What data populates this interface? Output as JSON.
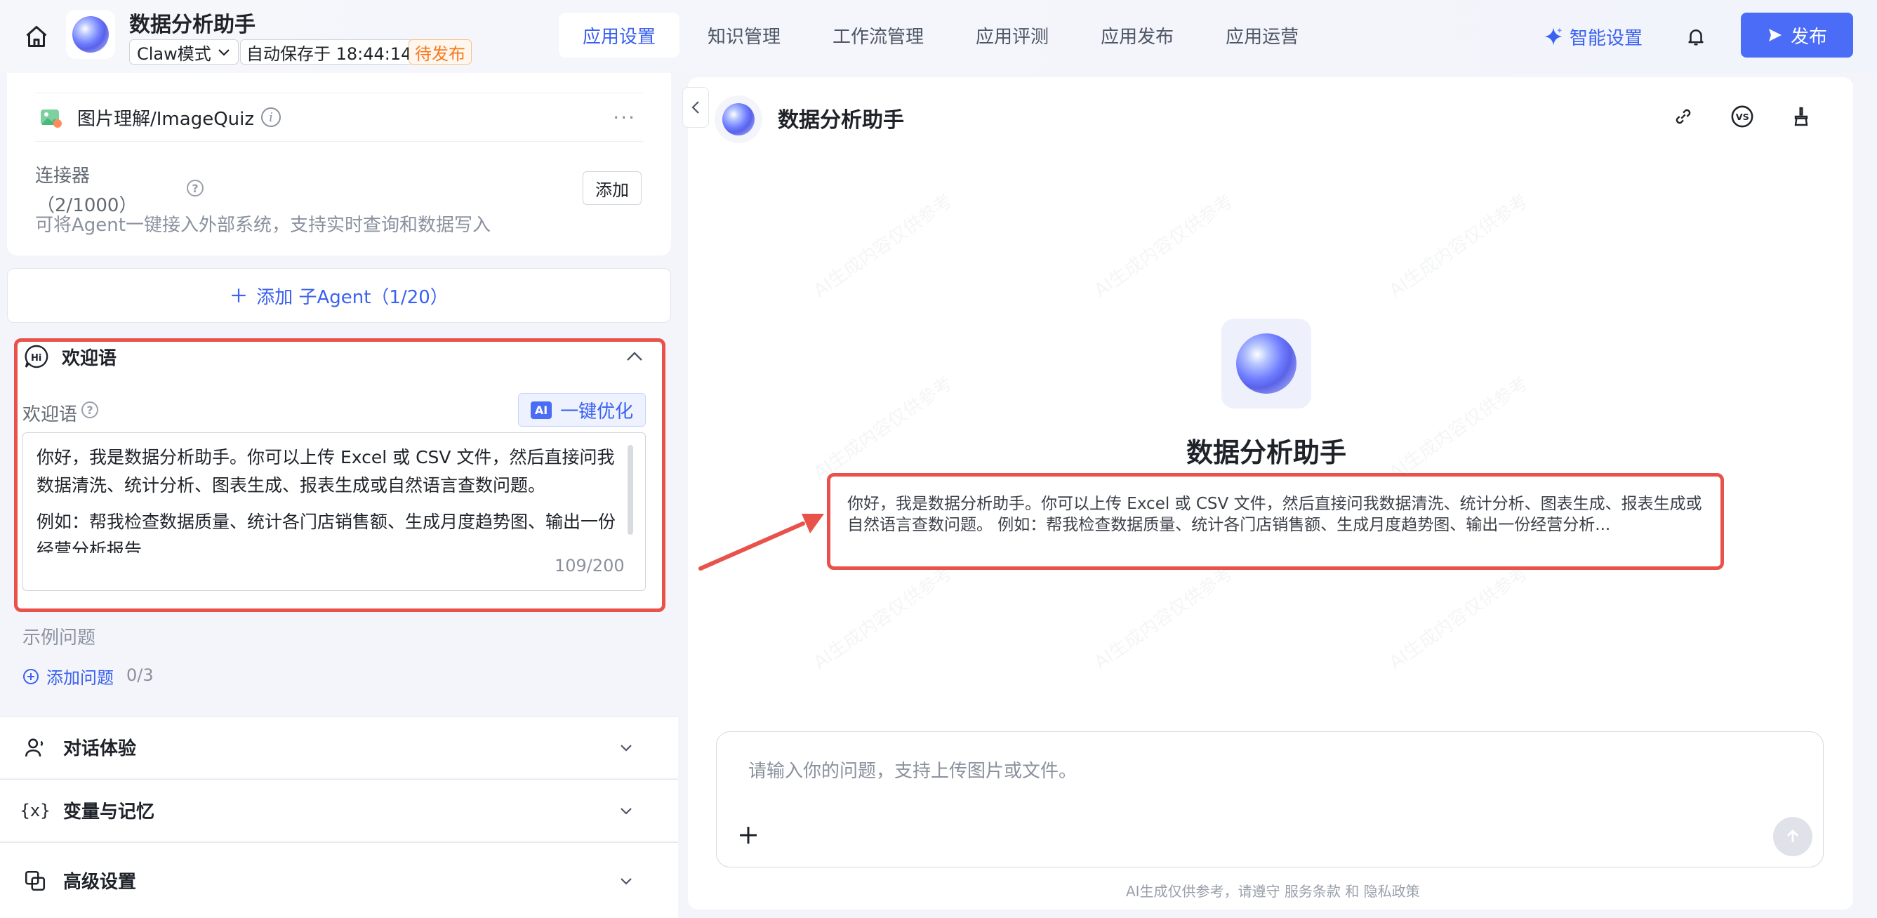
{
  "header": {
    "app_title": "数据分析助手",
    "mode_value": "Claw模式",
    "autosave": "自动保存于 18:44:14",
    "status_badge": "待发布",
    "tabs": [
      {
        "label": "应用设置",
        "active": true
      },
      {
        "label": "知识管理",
        "active": false
      },
      {
        "label": "工作流管理",
        "active": false
      },
      {
        "label": "应用评测",
        "active": false
      },
      {
        "label": "应用发布",
        "active": false
      },
      {
        "label": "应用运营",
        "active": false
      }
    ],
    "smart_settings": "智能设置",
    "publish": "发布",
    "icons": [
      "home-icon",
      "sparkle-icon",
      "bell-icon",
      "send-icon"
    ]
  },
  "left": {
    "plugin": {
      "name": "图片理解/ImageQuiz",
      "more": "···"
    },
    "connector": {
      "label": "连接器",
      "count": "（2/1000）",
      "description": "可将Agent一键接入外部系统，支持实时查询和数据写入",
      "add": "添加"
    },
    "add_subagent": "添加 子Agent（1/20）",
    "welcome": {
      "section_title": "欢迎语",
      "field_label": "欢迎语",
      "optimize_chip": "AI",
      "optimize_label": "一键优化",
      "text_p1": "你好，我是数据分析助手。你可以上传 Excel 或 CSV 文件，然后直接问我数据清洗、统计分析、图表生成、报表生成或自然语言查数问题。",
      "text_p2": "例如：帮我检查数据质量、统计各门店销售额、生成月度趋势图、输出一份经营分析报告",
      "char_count": "109/200"
    },
    "examples": {
      "label": "示例问题",
      "add": "添加问题",
      "count": "0/3"
    },
    "sections": [
      {
        "label": "对话体验",
        "icon": "user-voice-icon"
      },
      {
        "label": "变量与记忆",
        "icon": "variable-icon"
      },
      {
        "label": "高级设置",
        "icon": "copy-settings-icon"
      }
    ]
  },
  "preview": {
    "title": "数据分析助手",
    "center_title": "数据分析助手",
    "welcome_text": "你好，我是数据分析助手。你可以上传 Excel 或 CSV 文件，然后直接问我数据清洗、统计分析、图表生成、报表生成或自然语言查数问题。 例如：帮我检查数据质量、统计各门店销售额、生成月度趋势图、输出一份经营分析...",
    "input_placeholder": "请输入你的问题，支持上传图片或文件。",
    "disclaimer": "AI生成仅供参考，请遵守 服务条款 和 隐私政策",
    "watermark": "AI生成内容仅供参考",
    "tool_icons": [
      "link-icon",
      "vs-icon",
      "broom-icon"
    ]
  },
  "colors": {
    "accent": "#4a6cf7",
    "highlight_border": "#e8524a",
    "pending": "#f77a1e"
  }
}
